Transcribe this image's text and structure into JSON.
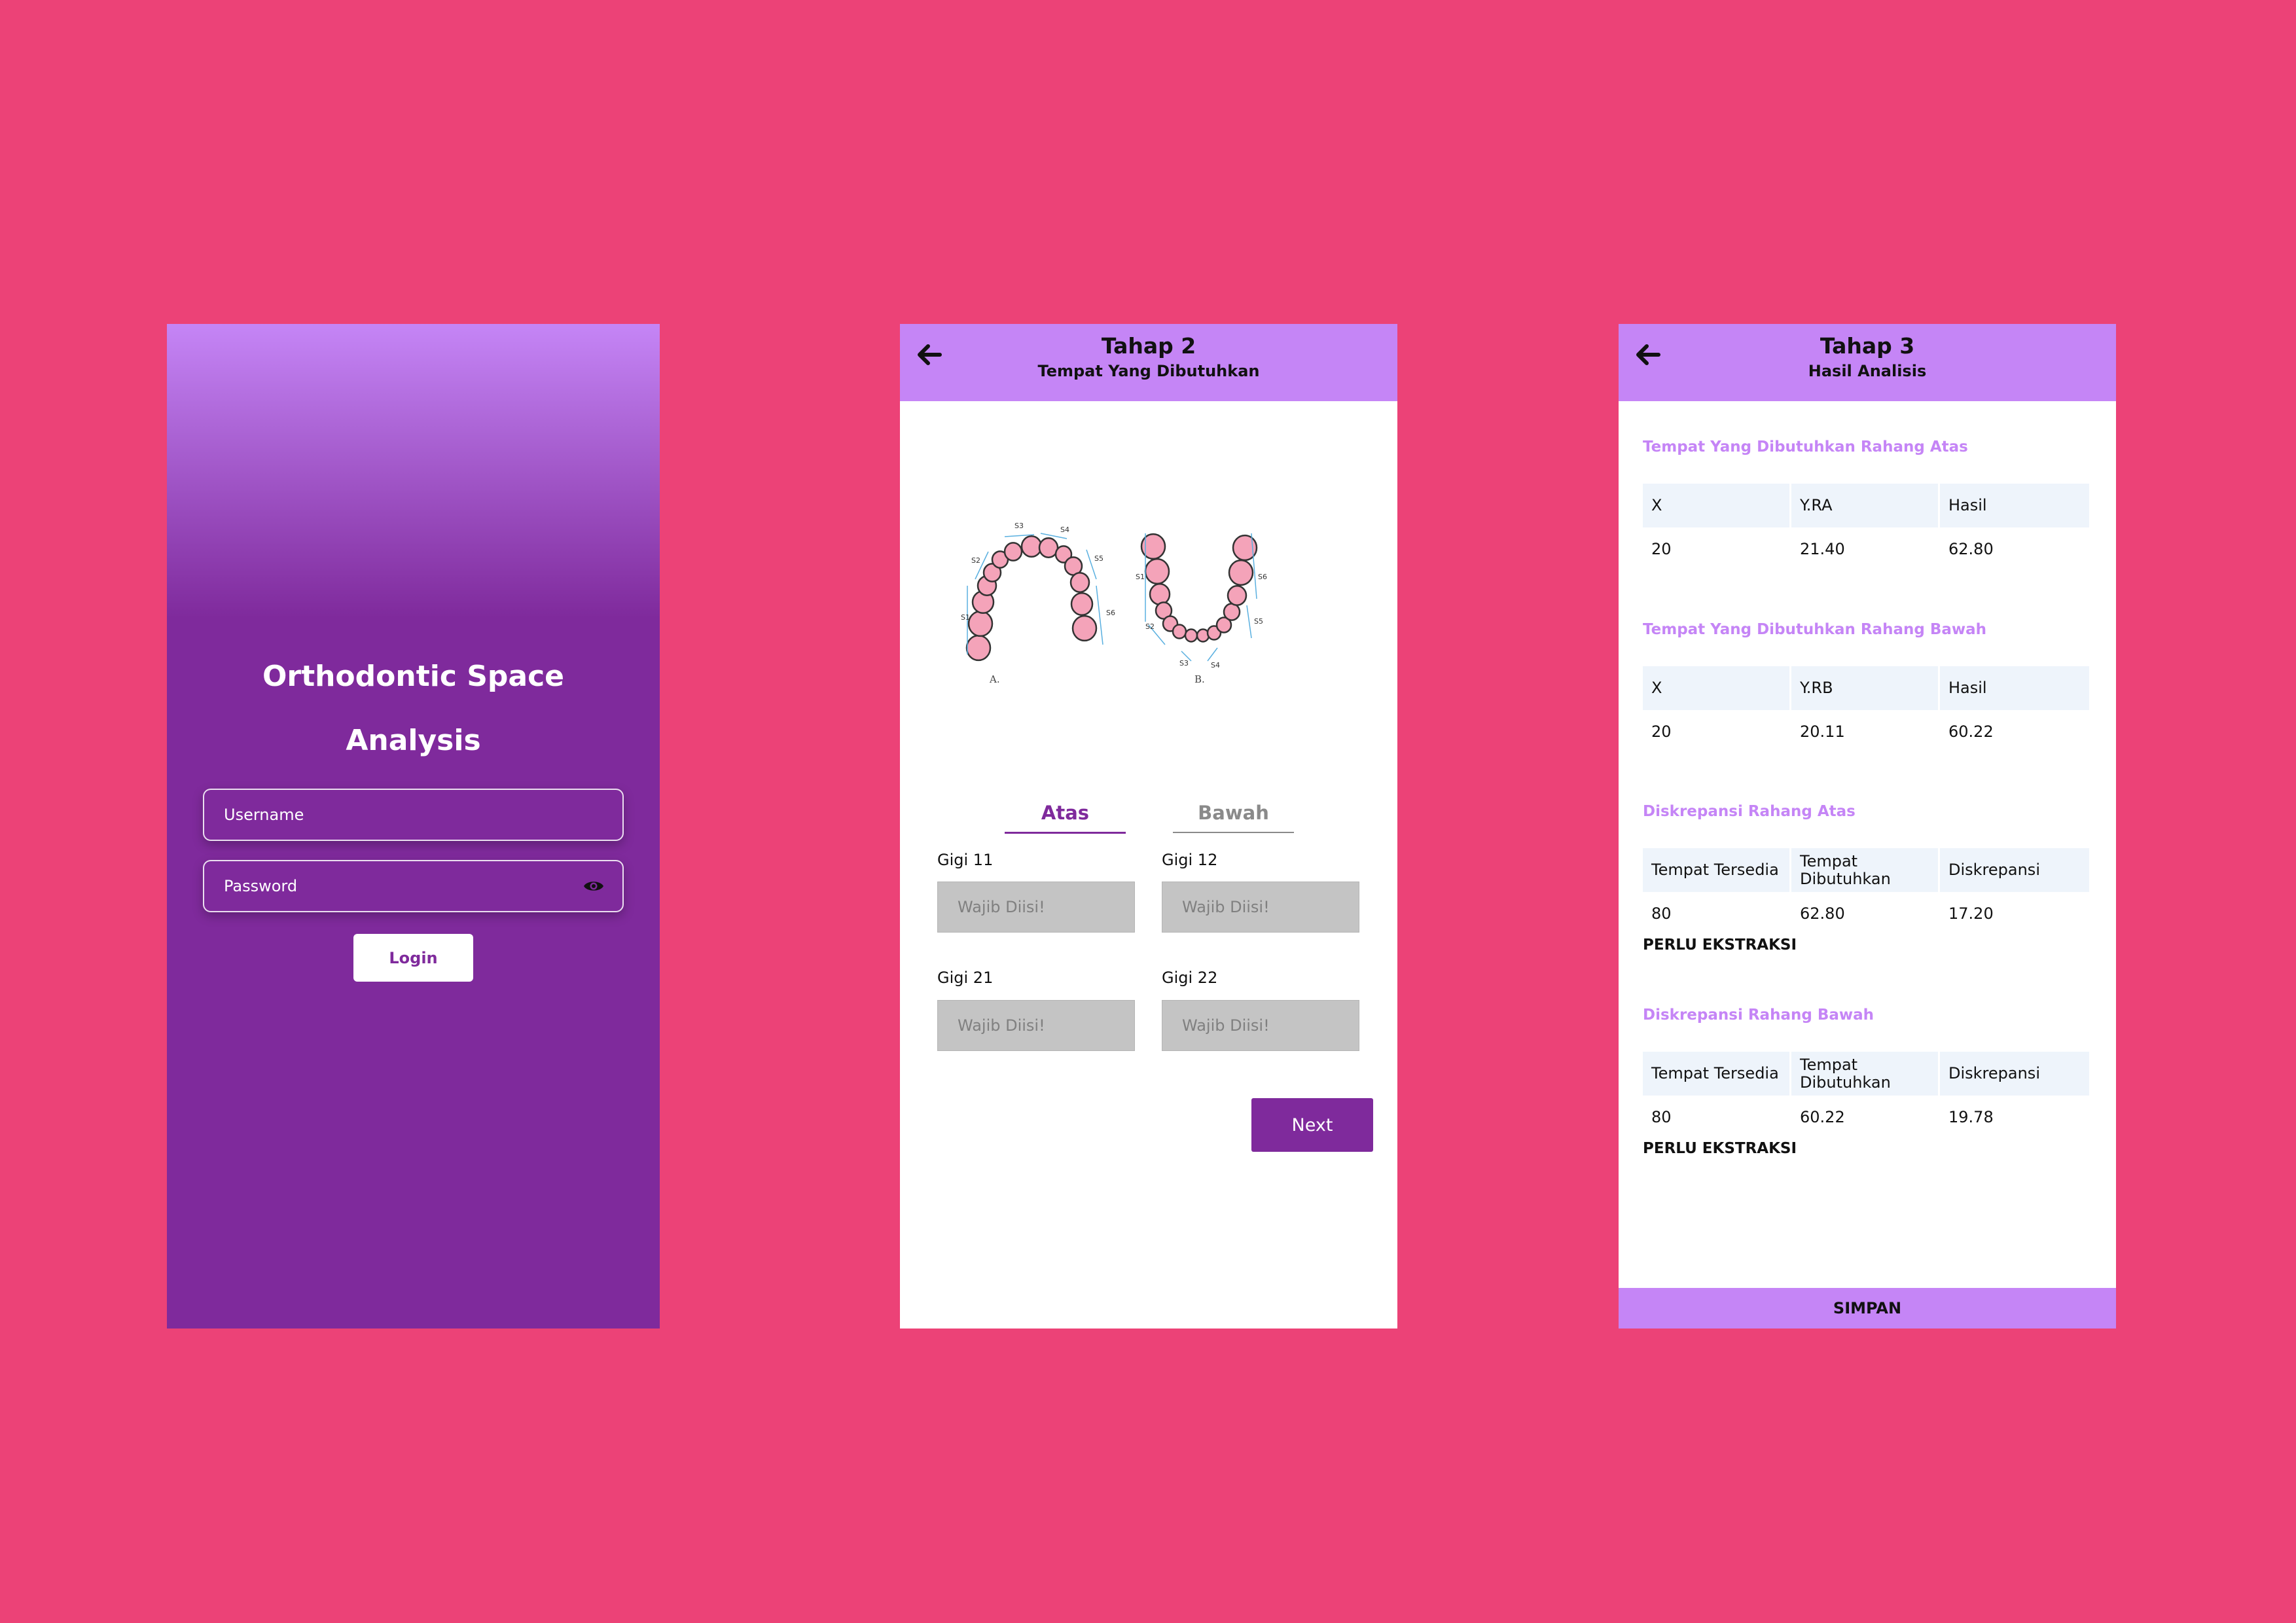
{
  "login": {
    "title_line1": "Orthodontic Space",
    "title_line2": "Analysis",
    "username_placeholder": "Username",
    "password_placeholder": "Password",
    "login_label": "Login"
  },
  "tahap2": {
    "title": "Tahap 2",
    "subtitle": "Tempat Yang Dibutuhkan",
    "diagram": {
      "labels_a": [
        "S1",
        "S2",
        "S3",
        "S4",
        "S5",
        "S6"
      ],
      "labels_b": [
        "S1",
        "S2",
        "S3",
        "S4",
        "S5",
        "S6"
      ],
      "caption_a": "A.",
      "caption_b": "B."
    },
    "tabs": [
      "Atas",
      "Bawah"
    ],
    "active_tab": "Atas",
    "fields": [
      {
        "label": "Gigi 11",
        "placeholder": "Wajib Diisi!"
      },
      {
        "label": "Gigi 12",
        "placeholder": "Wajib Diisi!"
      },
      {
        "label": "Gigi 21",
        "placeholder": "Wajib Diisi!"
      },
      {
        "label": "Gigi 22",
        "placeholder": "Wajib Diisi!"
      }
    ],
    "next_label": "Next"
  },
  "tahap3": {
    "title": "Tahap 3",
    "subtitle": "Hasil Analisis",
    "sections": [
      {
        "title": "Tempat Yang Dibutuhkan Rahang Atas",
        "headers": [
          "X",
          "Y.RA",
          "Hasil"
        ],
        "values": [
          "20",
          "21.40",
          "62.80"
        ]
      },
      {
        "title": "Tempat Yang Dibutuhkan Rahang Bawah",
        "headers": [
          "X",
          "Y.RB",
          "Hasil"
        ],
        "values": [
          "20",
          "20.11",
          "60.22"
        ]
      },
      {
        "title": "Diskrepansi Rahang Atas",
        "headers": [
          "Tempat Tersedia",
          "Tempat Dibutuhkan",
          "Diskrepansi"
        ],
        "values": [
          "80",
          "62.80",
          "17.20"
        ],
        "note": "PERLU EKSTRAKSI"
      },
      {
        "title": "Diskrepansi Rahang Bawah",
        "headers": [
          "Tempat Tersedia",
          "Tempat Dibutuhkan",
          "Diskrepansi"
        ],
        "values": [
          "80",
          "60.22",
          "19.78"
        ],
        "note": "PERLU EKSTRAKSI"
      }
    ],
    "save_label": "SIMPAN"
  },
  "colors": {
    "background": "#EC4277",
    "header": "#C585F6",
    "primary": "#7F2A9C",
    "input_gray": "#C4C4C4",
    "table_header": "#EEF4FB"
  }
}
